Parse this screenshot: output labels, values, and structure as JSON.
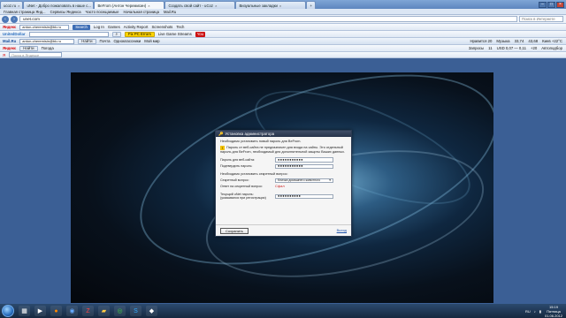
{
  "tabs": [
    {
      "label": "ucoz.ru",
      "active": false
    },
    {
      "label": "uNet - Добро пожаловать в наше с...",
      "active": false
    },
    {
      "label": "BeFrom (Антон Черемисин)",
      "active": true
    },
    {
      "label": "Создать свой сайт - uCoz",
      "active": false
    },
    {
      "label": "Визуальные закладки",
      "active": false
    }
  ],
  "bookmarks": [
    "Главная страница Янд...",
    "Сервисы Яндекса",
    "Часто посещаемые",
    "Начальная страница",
    "Mail.Ru"
  ],
  "address": {
    "url": "unet.com",
    "search_placeholder": "Поиск в Интернете"
  },
  "tb1": {
    "brand": "Яндекс",
    "account": "anton-cheremisin@bk.ru",
    "search_btn": "Search",
    "login": "Log In",
    "games": "Games",
    "activity": "Activity Report",
    "screenshots": "Screenshots",
    "extra": "Tech"
  },
  "tb2": {
    "brand": "UnitedDollar",
    "pc_errors": "Fix PC Errors",
    "live": "Live Game Streams",
    "yt": "You"
  },
  "tb3": {
    "mail": "Mail.Ru",
    "account": "anton-cheremisin@bk.ru",
    "find": "Найти",
    "mail_link": "Почта",
    "ok": "Одноклассники",
    "my": "Мой мир",
    "likes": "Нравится 20",
    "music": "Музыка",
    "usd": "33,74",
    "eur": "43,68",
    "weather": "Киев +22°C"
  },
  "tb4": {
    "brand": "Яндекс",
    "find": "Найти",
    "weather": "Погода",
    "requests": "Запросы",
    "cnt": "11",
    "rate": "USD 0,07 — 0,11",
    "forecast": "Автоподбор",
    "temp": "+20"
  },
  "tb5": {
    "search_placeholder": "Поиск в Яндексе"
  },
  "dialog": {
    "title": "Установка администратора",
    "intro": "Необходимо установить новый пароль для BeFrom.",
    "warning": "Пароль от веб-сайта не предназначен для входа на сайты. Это отдельный пароль для BeFrom, необходимый для дополнительной защиты Ваших данных.",
    "pw_label": "Пароль для веб-сайта:",
    "pw_value": "●●●●●●●●●●●",
    "confirm_label": "Подтвердить пароль:",
    "confirm_value": "●●●●●●●●●●●",
    "secret_intro": "Необходимо установить секретный вопрос:",
    "question_label": "Секретный вопрос:",
    "question_value": "Кличка домашнего животного",
    "answer_label": "Ответ на секретный вопрос:",
    "answer_value": "Сфал",
    "current_label": "Текущий uNet пароль:",
    "current_sub": "(указывался при регистрации)",
    "current_value": "●●●●●●●●●●",
    "save_btn": "Сохранить",
    "exit_link": "Выход"
  },
  "taskbar": {
    "lang": "RU",
    "time": "15:19",
    "day": "Пятница",
    "date": "01.06.2012"
  }
}
